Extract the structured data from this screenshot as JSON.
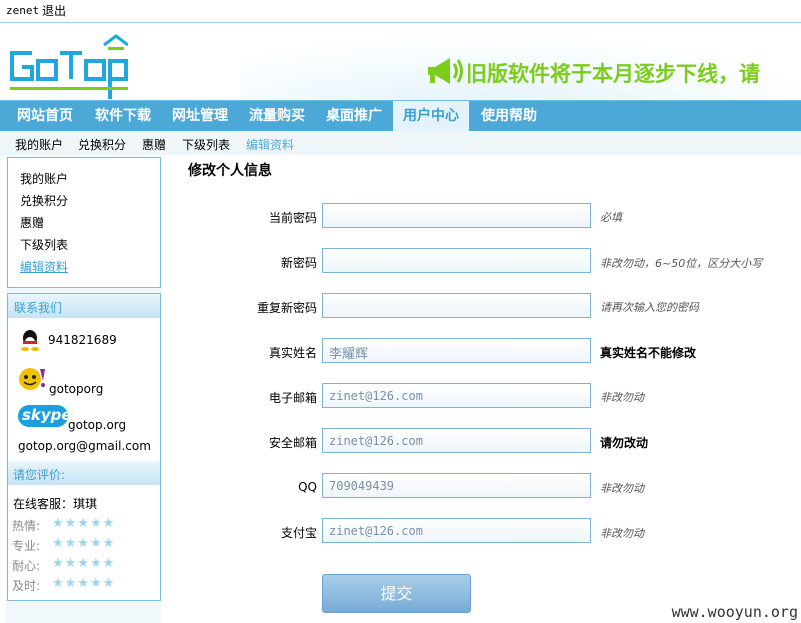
{
  "topbar": {
    "username": "zenet",
    "logout_label": "退出"
  },
  "header": {
    "notice_text": "旧版软件将于本月逐步下线，请",
    "brand_color": "#1fa8e0",
    "notice_color": "#7ccc1c"
  },
  "nav": {
    "items": [
      {
        "label": "网站首页"
      },
      {
        "label": "软件下载"
      },
      {
        "label": "网址管理"
      },
      {
        "label": "流量购买"
      },
      {
        "label": "桌面推广"
      },
      {
        "label": "用户中心",
        "active": true
      },
      {
        "label": "使用帮助"
      }
    ]
  },
  "subnav": {
    "items": [
      {
        "label": "我的账户"
      },
      {
        "label": "兑换积分"
      },
      {
        "label": "惠赠"
      },
      {
        "label": "下级列表"
      },
      {
        "label": "编辑资料",
        "active": true
      }
    ]
  },
  "sidebar": {
    "links": [
      {
        "label": "我的账户"
      },
      {
        "label": "兑换积分"
      },
      {
        "label": "惠赠"
      },
      {
        "label": "下级列表"
      },
      {
        "label": "编辑资料",
        "active": true
      }
    ],
    "contact": {
      "title": "联系我们",
      "qq": "941821689",
      "yahoo": "gotoporg",
      "skype_logo": "skype",
      "skype": "gotop.org",
      "email": "gotop.org@gmail.com"
    },
    "rating": {
      "title": "请您评价:",
      "service": "在线客服：琪琪",
      "rows": [
        {
          "label": "热情:"
        },
        {
          "label": "专业:"
        },
        {
          "label": "耐心:"
        },
        {
          "label": "及时:"
        }
      ],
      "stars": "★★★★★"
    }
  },
  "form": {
    "title": "修改个人信息",
    "fields": [
      {
        "label": "当前密码",
        "value": "",
        "hint": "必填"
      },
      {
        "label": "新密码",
        "value": "",
        "hint": "非改勿动，6~50位，区分大小写"
      },
      {
        "label": "重复新密码",
        "value": "",
        "hint": "请再次输入您的密码"
      },
      {
        "label": "真实姓名",
        "value": "李耀辉",
        "hint": "真实姓名不能修改"
      },
      {
        "label": "电子邮箱",
        "value": "zinet@126.com",
        "hint": "非改勿动"
      },
      {
        "label": "安全邮箱",
        "value": "zinet@126.com",
        "hint": "请勿改动"
      },
      {
        "label": "QQ",
        "value": "709049439",
        "hint": "非改勿动"
      },
      {
        "label": "支付宝",
        "value": "zinet@126.com",
        "hint": "非改勿动"
      }
    ],
    "submit_label": "提交"
  },
  "watermark": "www.wooyun.org"
}
